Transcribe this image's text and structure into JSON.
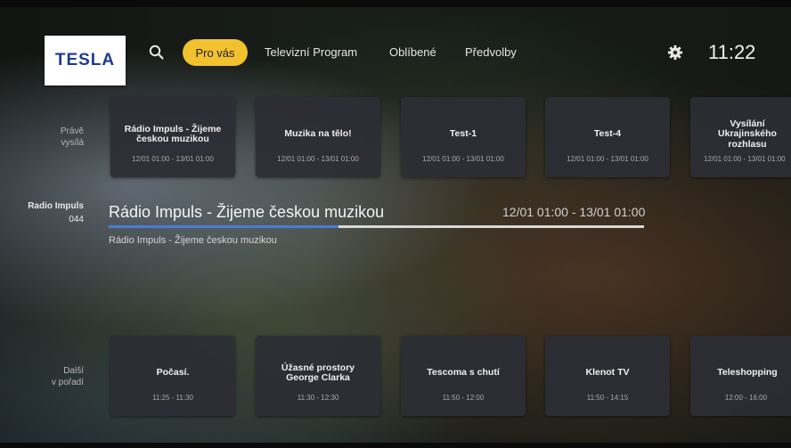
{
  "header": {
    "logo_text": "TESLA",
    "search_icon": "search-icon",
    "tabs": [
      {
        "label": "Pro vás",
        "active": true
      },
      {
        "label": "Televizní Program",
        "active": false
      },
      {
        "label": "Oblíbené",
        "active": false
      },
      {
        "label": "Předvolby",
        "active": false
      }
    ],
    "settings_icon": "gear-icon",
    "clock": "11:22",
    "accent_color": "#f2c12e"
  },
  "now_row": {
    "label_line1": "Právě",
    "label_line2": "vysílá",
    "cards": [
      {
        "title": "Rádio Impuls - Žijeme českou muzikou",
        "time": "12/01 01:00 - 13/01 01:00"
      },
      {
        "title": "Muzika na tělo!",
        "time": "12/01 01:00 - 13/01 01:00"
      },
      {
        "title": "Test-1",
        "time": "12/01 01:00 - 13/01 01:00"
      },
      {
        "title": "Test-4",
        "time": "12/01 01:00 - 13/01 01:00"
      },
      {
        "title": "Vysílání Ukrajinského rozhlasu",
        "time": "12/01 01:00 - 13/01 01:00"
      }
    ]
  },
  "current": {
    "channel_name": "Radio Impuls",
    "channel_number": "044",
    "program_title": "Rádio Impuls - Žijeme českou muzikou",
    "program_time": "12/01 01:00 - 13/01 01:00",
    "progress": 0.43,
    "description": "Rádio Impuls - Žijeme českou muzikou",
    "progress_color": "#4b7bd4"
  },
  "next_row": {
    "label_line1": "Další",
    "label_line2": "v pořadí",
    "cards": [
      {
        "title": "Počasí.",
        "time": "11:25 - 11:30"
      },
      {
        "title": "Úžasné prostory George Clarka",
        "time": "11:30 - 12:30"
      },
      {
        "title": "Tescoma s chutí",
        "time": "11:50 - 12:00"
      },
      {
        "title": "Klenot TV",
        "time": "11:50 - 14:15"
      },
      {
        "title": "Teleshopping",
        "time": "12:00 - 16:00"
      }
    ]
  }
}
